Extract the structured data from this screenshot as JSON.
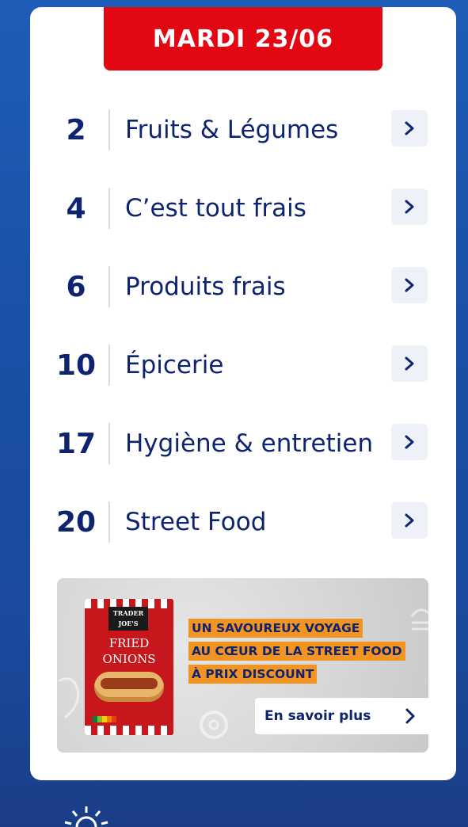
{
  "header": {
    "date": "MARDI 23/06"
  },
  "menu": [
    {
      "page": "2",
      "label": "Fruits & Légumes"
    },
    {
      "page": "4",
      "label": "C’est tout frais"
    },
    {
      "page": "6",
      "label": "Produits frais"
    },
    {
      "page": "10",
      "label": "Épicerie"
    },
    {
      "page": "17",
      "label": "Hygiène & entretien"
    },
    {
      "page": "20",
      "label": "Street Food"
    }
  ],
  "promo": {
    "pack_brand_line1": "TRADER",
    "pack_brand_line2": "JOE'S",
    "pack_title_line1": "FRIED",
    "pack_title_line2": "ONIONS",
    "tagline": [
      "UN SAVOUREUX VOYAGE",
      "AU CŒUR DE LA STREET FOOD",
      "À PRIX DISCOUNT"
    ],
    "cta_label": "En savoir plus"
  },
  "colors": {
    "accent_red": "#e30613",
    "navy": "#0f2470",
    "orange": "#f39322",
    "background_blue": "#1d5db8"
  },
  "icons": {
    "row_chevron": "chevron-right-icon",
    "cta_chevron": "chevron-right-icon",
    "bottom": "sun-icon"
  }
}
